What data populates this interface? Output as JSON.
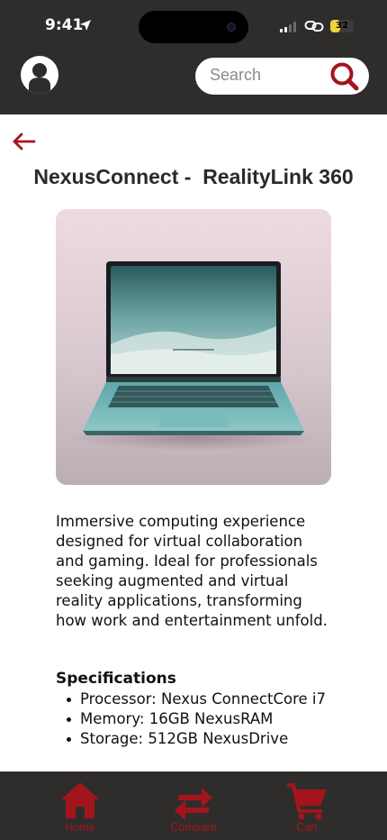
{
  "status_bar": {
    "time": "9:41",
    "battery": "32"
  },
  "header": {
    "search": {
      "placeholder": "Search"
    }
  },
  "product": {
    "title": "NexusConnect -  RealityLink 360",
    "description": "Immersive computing experience designed for virtual collaboration and gaming. Ideal for professionals seeking augmented and virtual reality applications, transforming how work and entertainment unfold.",
    "specs_title": "Specifications",
    "specs": [
      "Processor: Nexus ConnectCore i7",
      "Memory: 16GB NexusRAM",
      "Storage: 512GB NexusDrive"
    ]
  },
  "nav": {
    "home": "Home",
    "compare": "Compare",
    "cart": "Cart"
  },
  "colors": {
    "brand_red": "#a3151c",
    "header_bg": "#2e2d2c"
  }
}
